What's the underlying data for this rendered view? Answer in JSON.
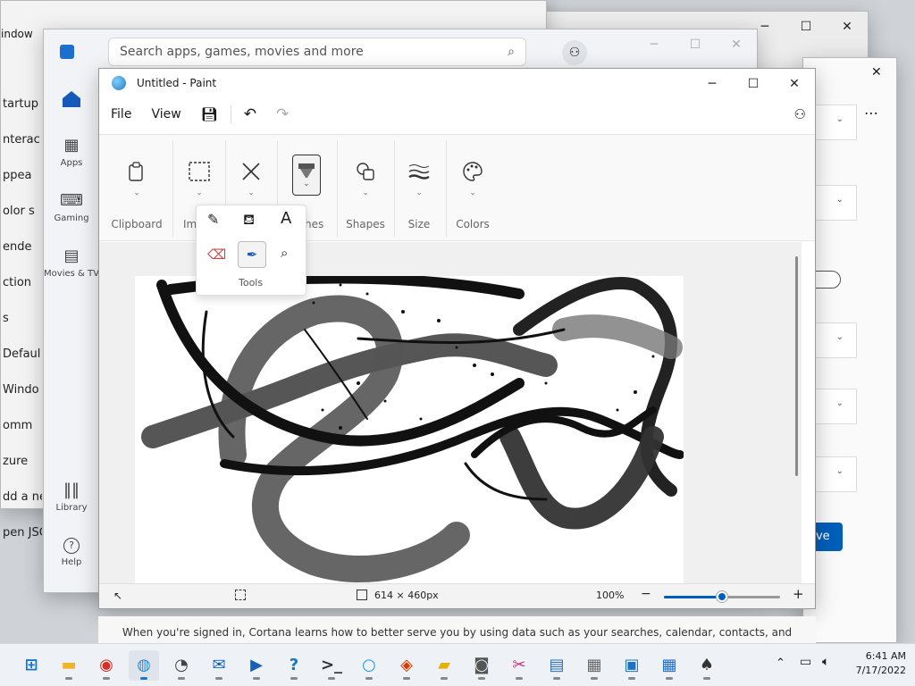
{
  "background": {
    "settings_title": "indow",
    "settings_items": [
      "tartup",
      "nterac",
      "ppea",
      "olor s",
      "ende",
      "ction",
      "s",
      "Defaul",
      "Windo",
      "omm",
      "zure",
      "dd a ne",
      "pen JSO"
    ],
    "save_fragment": "ave"
  },
  "store": {
    "search_placeholder": "Search apps, games, movies and more",
    "nav": [
      {
        "label": ""
      },
      {
        "label": "Apps"
      },
      {
        "label": "Gaming"
      },
      {
        "label": "Movies & TV"
      },
      {
        "label": "Library"
      },
      {
        "label": "Help"
      }
    ]
  },
  "paint": {
    "title": "Untitled - Paint",
    "menu": {
      "file": "File",
      "view": "View"
    },
    "ribbon": {
      "clipboard": "Clipboard",
      "image_fragment": "Im",
      "brushes_fragment": "hes",
      "shapes": "Shapes",
      "size": "Size",
      "colors": "Colors"
    },
    "tools_flyout_label": "Tools",
    "status": {
      "dimensions": "614 × 460px",
      "zoom": "100%",
      "zoom_level": 0.5
    }
  },
  "cortana_text": "When you're signed in, Cortana learns how to better serve you by using data such as your searches, calendar, contacts, and location.",
  "taskbar": {
    "time": "6:41 AM",
    "date": "7/17/2022",
    "apps": [
      "start-icon",
      "file-explorer-icon",
      "chrome-icon",
      "paint-icon",
      "clock-icon",
      "mail-icon",
      "movies-icon",
      "get-help-icon",
      "terminal-icon",
      "cortana-icon",
      "office-icon",
      "sticky-notes-icon",
      "camera-icon",
      "snipping-tool-icon",
      "notepad-icon",
      "calculator-icon",
      "remote-desktop-icon",
      "store-icon",
      "solitaire-icon"
    ]
  }
}
